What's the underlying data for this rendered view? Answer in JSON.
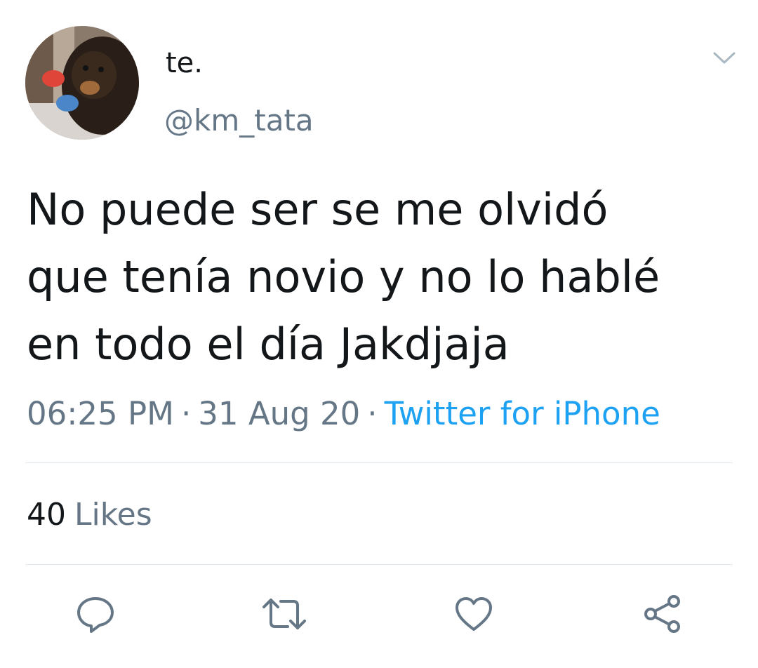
{
  "author": {
    "display_name": "te.",
    "handle": "@km_tata",
    "avatar_icon": "avatar-dog-photo"
  },
  "tweet": {
    "text_lines": [
      "No puede ser se me olvidó",
      "que tenía novio y no lo hablé",
      "en todo el día Jakdjaja"
    ],
    "time": "06:25 PM",
    "date": "31 Aug 20",
    "separator": "·",
    "source": "Twitter for iPhone"
  },
  "stats": {
    "likes_count": "40",
    "likes_label": "Likes"
  },
  "actions": {
    "reply_icon": "reply-icon",
    "retweet_icon": "retweet-icon",
    "like_icon": "heart-icon",
    "share_icon": "share-icon",
    "menu_icon": "chevron-down-icon"
  },
  "colors": {
    "text": "#14171a",
    "secondary": "#657786",
    "link": "#1da1f2",
    "divider": "#e1e8ed",
    "icon": "#657786"
  }
}
